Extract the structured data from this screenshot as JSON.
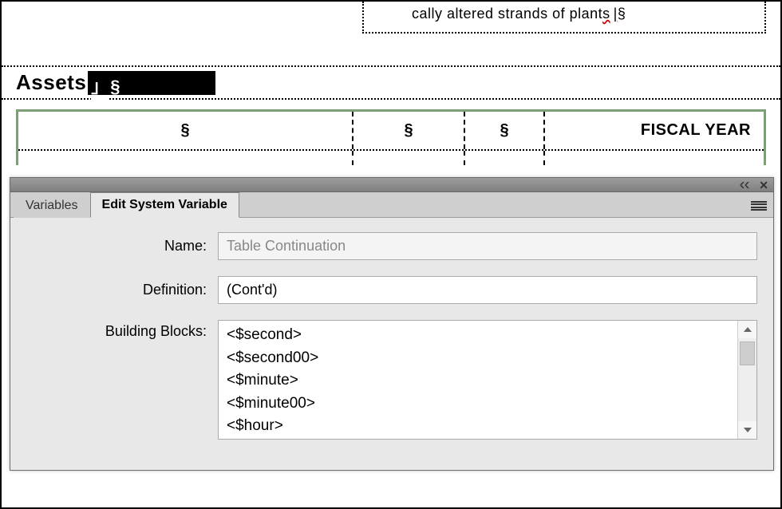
{
  "doc": {
    "top_line": "cally altered strands of plant",
    "top_line_tail": "s",
    "heading": "Assets",
    "para_symbol": "§",
    "table": {
      "col4": "FISCAL YEAR"
    }
  },
  "panel": {
    "tabs": {
      "variables": "Variables",
      "edit_system": "Edit System Variable"
    },
    "fields": {
      "name_label": "Name:",
      "name_value": "Table Continuation",
      "definition_label": "Definition:",
      "definition_value": "(Cont'd)",
      "building_blocks_label": "Building Blocks:"
    },
    "building_blocks": [
      "<$second>",
      "<$second00>",
      "<$minute>",
      "<$minute00>",
      "<$hour>"
    ]
  }
}
